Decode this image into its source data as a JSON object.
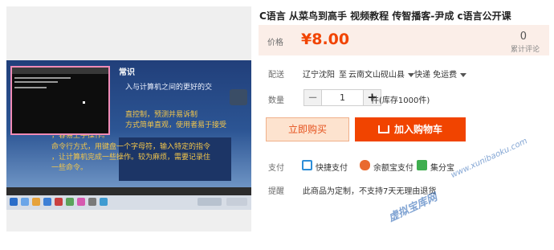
{
  "product": {
    "title": "C语言 从菜鸟到高手 视频教程 传智播客-尹成 c语言公开课"
  },
  "video": {
    "slide_title": "常识",
    "slide_lines": [
      "入与计算机之间的更好的交",
      "直控制，预测并易诉制",
      "方式简单直观，使用者易于接受",
      "，容易上手操作。",
      "命令行方式，用键盘一个字母符，输入特定的指令",
      "，让计算机完成一些操作。较为麻烦，需要记录住",
      "一些命令。"
    ]
  },
  "price": {
    "label": "价格",
    "value": "¥8.00",
    "review_count": "0",
    "review_label": "累计评论"
  },
  "shipping": {
    "label": "配送",
    "from": "辽宁沈阳",
    "to_word": "至",
    "destination": "云南文山砚山县",
    "method": "快递 免运费"
  },
  "quantity": {
    "label": "数量",
    "minus": "−",
    "value": "1",
    "plus": "+",
    "stock": "件(库存1000件)"
  },
  "actions": {
    "buy_now": "立即购买",
    "add_cart": "加入购物车"
  },
  "payment": {
    "label": "支付",
    "methods": [
      "快捷支付",
      "余额宝支付",
      "集分宝"
    ]
  },
  "tip": {
    "label": "提醒",
    "text": "此商品为定制，不支持7天无理由退货"
  },
  "watermarks": {
    "url": "www.xunibaoku.com",
    "name": "虚拟宝库网"
  },
  "colors": {
    "accent": "#f14400",
    "price_bg": "#fbeee8",
    "buy_now_bg": "#fde3cf"
  }
}
